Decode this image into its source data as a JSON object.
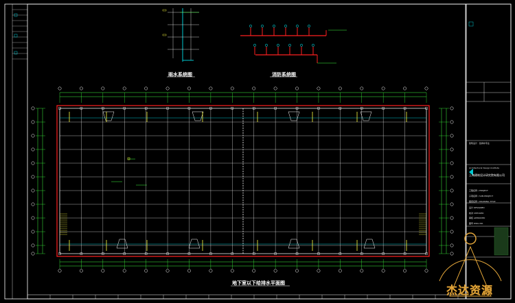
{
  "drawing": {
    "title_main": "地下室以下给排水平面图",
    "title_rain": "雨水系统图",
    "title_fire": "消防系统图"
  },
  "title_block": {
    "company": "上海建筑设计研究院有限公司",
    "lines": [
      "建筑设计 · 给排水专业",
      "Architectural Design Institute",
      "工程名称 / PROJECT",
      "子项名称 / SUB-PROJECT",
      "图纸名称 / DRAWING TITLE",
      "设计 DESIGNED",
      "校对 CHECKED",
      "审核 APPROVED",
      "图号 DWG NO."
    ]
  },
  "watermark": {
    "text": "杰达资源"
  },
  "colors": {
    "background": "#000000",
    "frame": "#ffffff",
    "grid_axis": "#ffffff",
    "outline": "#ff2020",
    "dim": "#40ff40",
    "pipe": "#00c8d0",
    "accent": "#ffff40",
    "watermark": "#e3a63a"
  }
}
